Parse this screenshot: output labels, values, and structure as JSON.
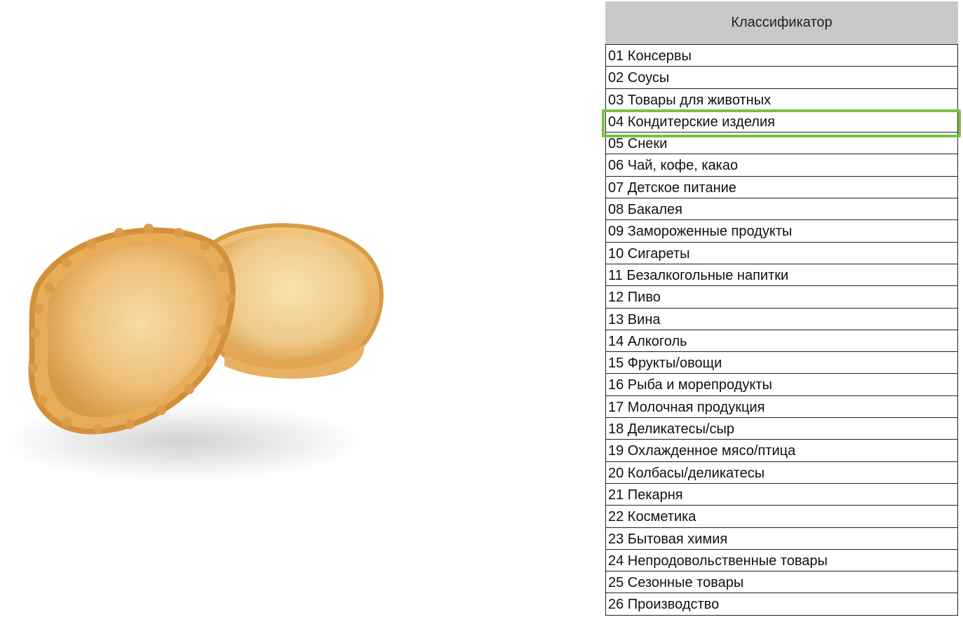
{
  "classifier": {
    "header": "Классификатор",
    "items": [
      {
        "label": "01 Консервы"
      },
      {
        "label": "02 Соусы"
      },
      {
        "label": "03 Товары для животных"
      },
      {
        "label": "04 Кондитерские изделия",
        "highlighted": true
      },
      {
        "label": "05 Снеки"
      },
      {
        "label": "06 Чай, кофе, какао"
      },
      {
        "label": "07 Детское питание"
      },
      {
        "label": "08 Бакалея"
      },
      {
        "label": "09 Замороженные продукты"
      },
      {
        "label": "10 Сигареты"
      },
      {
        "label": "11 Безалкогольные напитки"
      },
      {
        "label": "12 Пиво"
      },
      {
        "label": "13 Вина"
      },
      {
        "label": "14 Алкоголь"
      },
      {
        "label": "15 Фрукты/овощи"
      },
      {
        "label": "16 Рыба и морепродукты"
      },
      {
        "label": "17 Молочная продукция"
      },
      {
        "label": "18 Деликатесы/сыр"
      },
      {
        "label": "19 Охлажденное мясо/птица"
      },
      {
        "label": "20 Колбасы/деликатесы"
      },
      {
        "label": "21 Пекарня"
      },
      {
        "label": "22 Косметика"
      },
      {
        "label": "23 Бытовая химия"
      },
      {
        "label": "24 Непродовольственные товары"
      },
      {
        "label": "25 Сезонные товары"
      },
      {
        "label": "26 Производство"
      }
    ]
  },
  "colors": {
    "header_bg": "#c8c8c8",
    "highlight": "#7ac143",
    "pastry": "#e9b56a"
  },
  "product_image": {
    "icon": "tartlet-shells-icon"
  }
}
